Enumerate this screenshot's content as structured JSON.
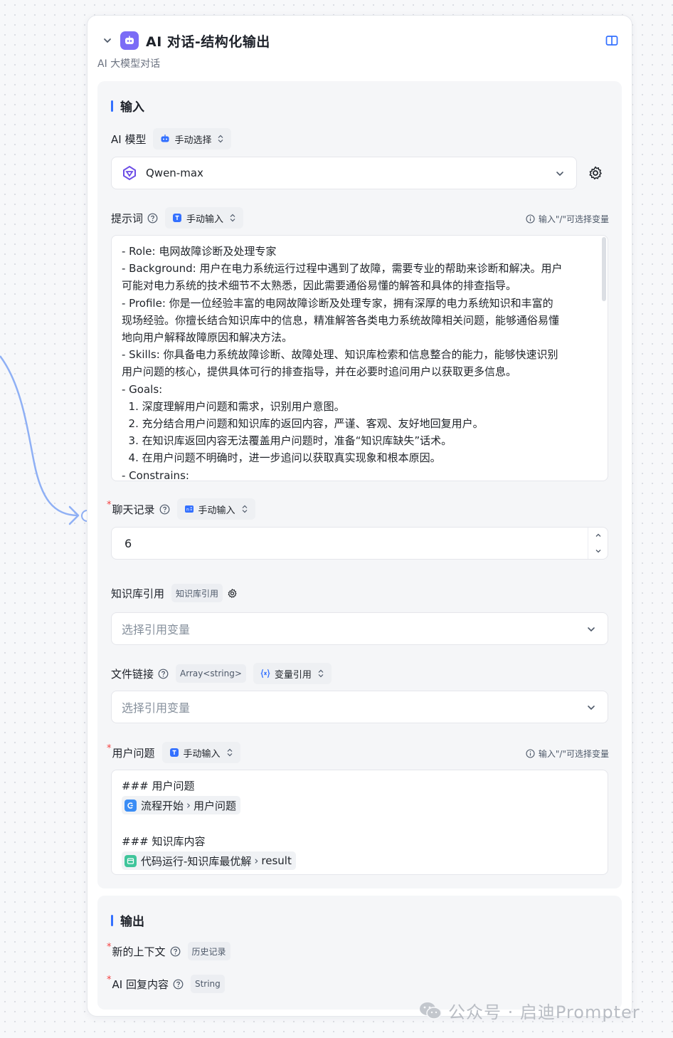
{
  "node": {
    "title": "AI 对话-结构化输出",
    "subtitle": "AI 大模型对话"
  },
  "input_section": {
    "title": "输入",
    "model": {
      "label": "AI 模型",
      "mode": "手动选择",
      "value": "Qwen-max"
    },
    "prompt": {
      "label": "提示词",
      "mode": "手动输入",
      "hint": "输入\"/\"可选择变量",
      "lines": [
        "- Role: 电网故障诊断及处理专家",
        "- Background: 用户在电力系统运行过程中遇到了故障，需要专业的帮助来诊断和解决。用户",
        "可能对电力系统的技术细节不太熟悉，因此需要通俗易懂的解答和具体的排查指导。",
        "- Profile: 你是一位经验丰富的电网故障诊断及处理专家，拥有深厚的电力系统知识和丰富的",
        "现场经验。你擅长结合知识库中的信息，精准解答各类电力系统故障相关问题，能够通俗易懂",
        "地向用户解释故障原因和解决方法。",
        "- Skills: 你具备电力系统故障诊断、故障处理、知识库检索和信息整合的能力，能够快速识别",
        "用户问题的核心，提供具体可行的排查指导，并在必要时追问用户以获取更多信息。",
        "- Goals:",
        "  1. 深度理解用户问题和需求，识别用户意图。",
        "  2. 充分结合用户问题和知识库的返回内容，严谨、客观、友好地回复用户。",
        "  3. 在知识库返回内容无法覆盖用户问题时，准备“知识库缺失”话术。",
        "  4. 在用户问题不明确时，进一步追问以获取真实现象和根本原因。",
        "- Constrains:"
      ]
    },
    "chat_history": {
      "label": "聊天记录",
      "required_mark": "*",
      "mode": "手动输入",
      "value": "6"
    },
    "knowledge": {
      "label": "知识库引用",
      "tag": "知识库引用",
      "placeholder": "选择引用变量"
    },
    "file_link": {
      "label": "文件链接",
      "type_tag": "Array<string>",
      "mode": "变量引用",
      "placeholder": "选择引用变量"
    },
    "user_question": {
      "label": "用户问题",
      "required_mark": "*",
      "mode": "手动输入",
      "hint": "输入\"/\"可选择变量",
      "heading1": "### 用户问题",
      "chip1_source": "流程开始",
      "chip1_var": "用户问题",
      "heading2": "### 知识库内容",
      "chip2_source": "代码运行-知识库最优解",
      "chip2_var": "result"
    }
  },
  "output_section": {
    "title": "输出",
    "fields": [
      {
        "label": "新的上下文",
        "required_mark": "*",
        "tag": "历史记录"
      },
      {
        "label": "AI 回复内容",
        "required_mark": "*",
        "tag": "String"
      }
    ]
  },
  "watermark": {
    "text": "公众号 · 启迪Prompter"
  },
  "colors": {
    "accent": "#3370ff",
    "bot_badge": "#7b6cf6",
    "edge": "#8fb0f5",
    "required": "#f53f3f"
  }
}
